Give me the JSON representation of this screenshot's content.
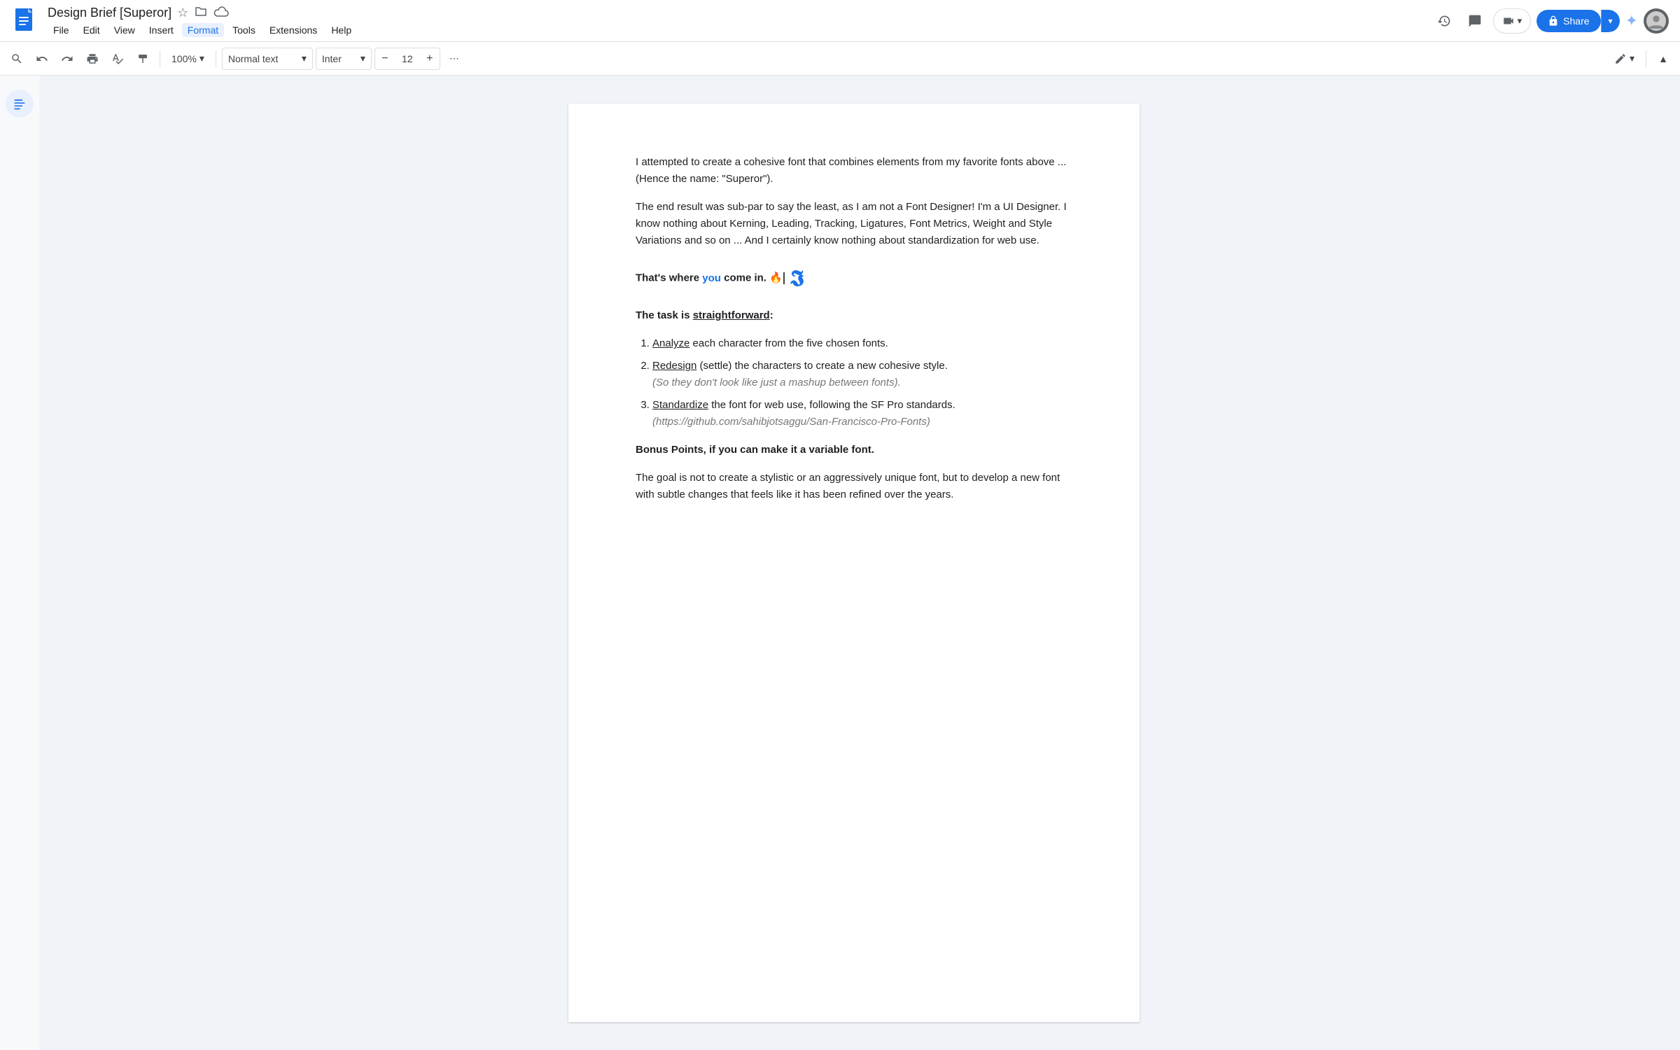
{
  "app": {
    "icon_color": "#4285f4",
    "title": "Design Brief [Superor]",
    "menu_items": [
      "File",
      "Edit",
      "View",
      "Insert",
      "Format",
      "Tools",
      "Extensions",
      "Help"
    ],
    "active_menu": "Format"
  },
  "toolbar": {
    "zoom": "100%",
    "zoom_dropdown_icon": "▾",
    "style_label": "Normal text",
    "style_dropdown_icon": "▾",
    "font_label": "Inter",
    "font_dropdown_icon": "▾",
    "font_size": "12",
    "more_options": "⋯",
    "edit_mode_icon": "✏",
    "edit_mode_dropdown_icon": "▾",
    "collapse_icon": "▲"
  },
  "topbar": {
    "history_icon": "🕐",
    "comment_icon": "💬",
    "meet_icon": "📹",
    "share_label": "Share",
    "lock_icon": "🔒",
    "gemini_icon": "✦"
  },
  "document": {
    "para1": "I attempted to create a cohesive font that combines elements from my favorite fonts above ...  (Hence the name: \"Superor\").",
    "para2": "The end result was sub-par to say the least, as I am not a Font Designer! I'm a UI Designer. I know nothing about Kerning, Leading, Tracking, Ligatures, Font Metrics, Weight and Style Variations and so on ... And I certainly know nothing about standardization for web use.",
    "para3_before": "That's where ",
    "para3_you": "you",
    "para3_after": " come in. 🔥",
    "para4_bold_prefix": "The task is ",
    "para4_bold_underline": "straightforward",
    "para4_bold_suffix": ":",
    "list_items": [
      {
        "label_underline": "Analyze",
        "label_rest": " each character from the five chosen fonts."
      },
      {
        "label_underline": "Redesign",
        "label_rest": " (settle) the characters to create a new cohesive style.",
        "note": "(So they don't look like just a mashup between fonts)."
      },
      {
        "label_underline": "Standardize",
        "label_rest": " the font for web use, following the SF Pro standards.",
        "note": "(https://github.com/sahibjotsaggu/San-Francisco-Pro-Fonts)"
      }
    ],
    "bonus": "Bonus Points, if you can make it a variable font.",
    "para5": "The goal is not to create a stylistic or an aggressively unique font, but to develop a new font with subtle changes that feels like it has been refined over the years."
  }
}
